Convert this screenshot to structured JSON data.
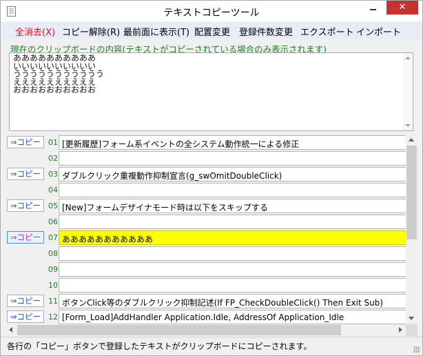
{
  "window": {
    "title": "テキストコピーツール",
    "close_glyph": "✕"
  },
  "menu": [
    {
      "label": "全消去(X)",
      "color": "#e2101c"
    },
    {
      "label": "コピー解除(R)"
    },
    {
      "label": "最前面に表示(T)"
    },
    {
      "label": "配置変更"
    },
    {
      "label": "登録件数変更"
    },
    {
      "label": "エクスポート"
    },
    {
      "label": "インポート"
    }
  ],
  "clipboard": {
    "label": "現在のクリップボードの内容(テキストがコピーされている場合のみ表示されます)",
    "content": "ああああああああああ\nいいいいいいいいいい\nううううううううううう\nええええええええええ\nおおおおおおおおおお"
  },
  "rows": [
    {
      "num": "01",
      "button": "⇒コピー",
      "text": "[更新履歴]フォーム系イベントの全システム動作統一による修正"
    },
    {
      "num": "02",
      "button": "",
      "text": ""
    },
    {
      "num": "03",
      "button": "⇒コピー",
      "text": "ダブルクリック重複動作抑制宣言(g_swOmitDoubleClick)"
    },
    {
      "num": "04",
      "button": "",
      "text": ""
    },
    {
      "num": "05",
      "button": "⇒コピー",
      "text": "[New]フォームデザイナモード時は以下をスキップする"
    },
    {
      "num": "06",
      "button": "",
      "text": ""
    },
    {
      "num": "07",
      "button": "⇒コピー",
      "text": "あああああああああああ",
      "active": true
    },
    {
      "num": "08",
      "button": "",
      "text": ""
    },
    {
      "num": "09",
      "button": "",
      "text": ""
    },
    {
      "num": "10",
      "button": "",
      "text": ""
    },
    {
      "num": "11",
      "button": "⇒コピー",
      "text": "ボタンClick等のダブルクリック抑制記述(If FP_CheckDoubleClick() Then Exit Sub)"
    },
    {
      "num": "12",
      "button": "⇒コピー",
      "text": "[Form_Load]AddHandler Application.Idle, AddressOf Application_Idle"
    }
  ],
  "status": {
    "text": "各行の「コピー」ボタンで登録したテキストがクリップボードにコピーされます。"
  },
  "colors": {
    "highlight": "#ffff00",
    "label_green": "#1e7d1e",
    "button_blue": "#1a4fcf",
    "button_active": "#d018c8",
    "close_red": "#c7312f"
  }
}
